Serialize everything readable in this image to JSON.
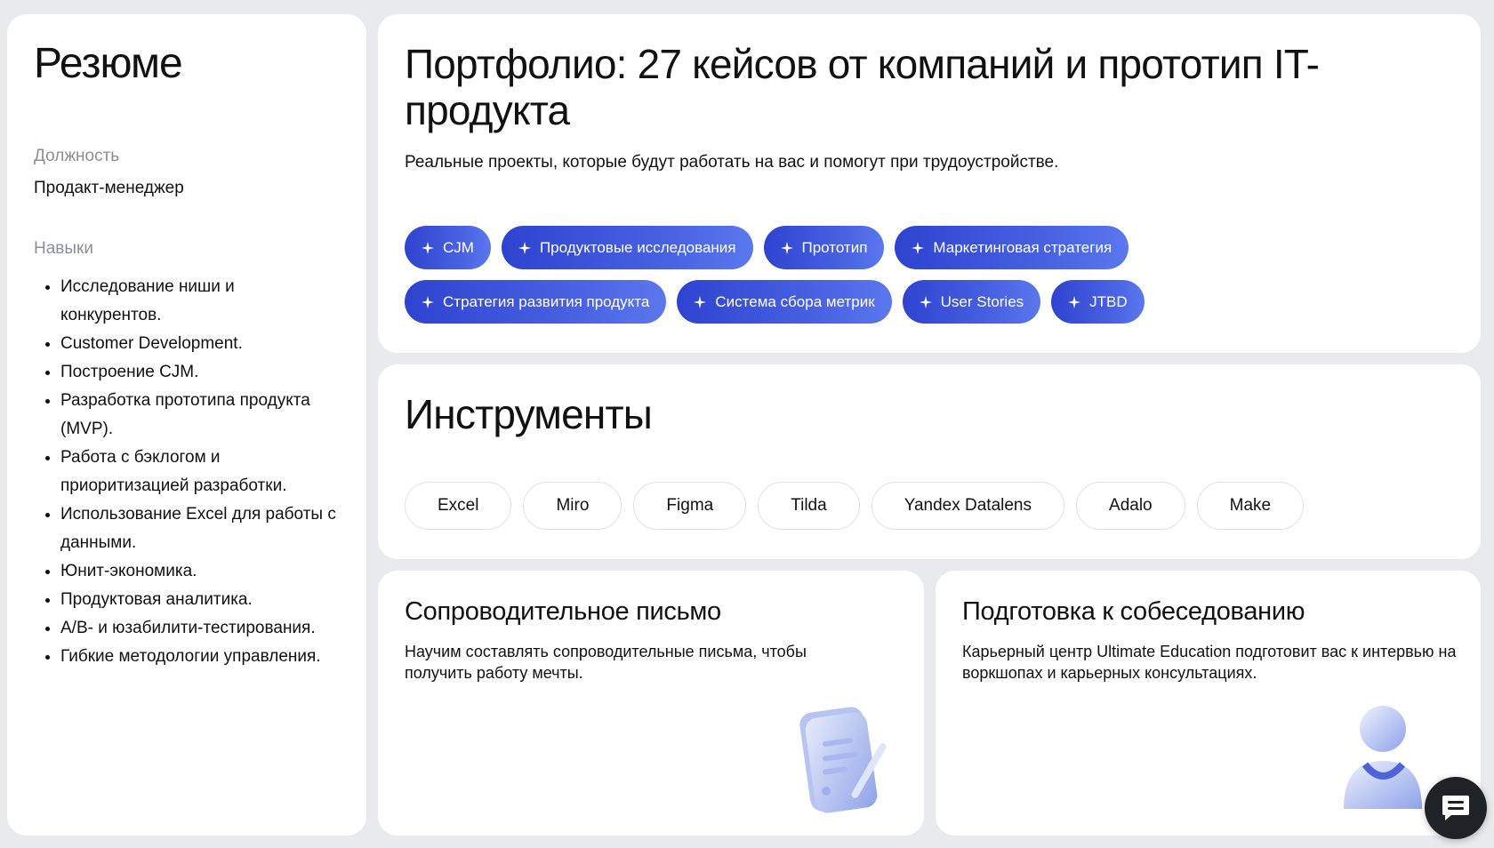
{
  "resume": {
    "title": "Резюме",
    "position_label": "Должность",
    "position_value": "Продакт-менеджер",
    "skills_label": "Навыки",
    "skills": [
      "Исследование ниши и конкурентов.",
      "Customer Development.",
      "Построение CJM.",
      "Разработка прототипа продукта (MVP).",
      "Работа с бэклогом и приоритизацией разработки.",
      "Использование Excel для работы с данными.",
      "Юнит-экономика.",
      "Продуктовая аналитика.",
      "A/B- и юзабилити-тестирования.",
      "Гибкие методологии управления."
    ]
  },
  "portfolio": {
    "title": "Портфолио: 27 кейсов от компаний и прототип IT-продукта",
    "subtitle": "Реальные проекты, которые будут работать на вас и помогут при трудоустройстве.",
    "chips": [
      "CJM",
      "Продуктовые исследования",
      "Прототип",
      "Маркетинговая стратегия",
      "Стратегия развития продукта",
      "Система сбора метрик",
      "User Stories",
      "JTBD"
    ]
  },
  "tools": {
    "title": "Инструменты",
    "items": [
      "Excel",
      "Miro",
      "Figma",
      "Tilda",
      "Yandex Datalens",
      "Adalo",
      "Make"
    ]
  },
  "letter": {
    "title": "Сопроводительное письмо",
    "description": "Научим составлять сопроводительные письма, чтобы получить работу мечты."
  },
  "interview": {
    "title": "Подготовка к собеседованию",
    "description": "Карьерный центр Ultimate Education подготовит вас к интервью на воркшопах и карьерных консультациях."
  },
  "icons": {
    "chip_icon": "sparkle-icon",
    "chat_button": "chat-icon"
  },
  "colors": {
    "chip_start": "#2f43cf",
    "chip_end": "#5b78ee",
    "background": "#e8eaee",
    "chat_button": "#1f2226"
  }
}
